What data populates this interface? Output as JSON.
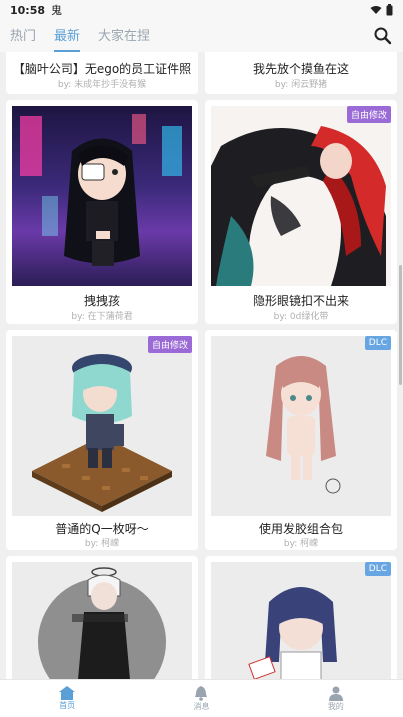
{
  "status": {
    "time": "10:58",
    "app_glyph": "鬼"
  },
  "tabs": [
    {
      "label": "热门"
    },
    {
      "label": "最新"
    },
    {
      "label": "大家在捏"
    }
  ],
  "cards": [
    {
      "title": "【脑叶公司】无ego的员工证件照",
      "author": "by: 末成年抄手没有猴",
      "badge": ""
    },
    {
      "title": "我先放个摸鱼在这",
      "author": "by: 闲云野猪",
      "badge": ""
    },
    {
      "title": "拽拽孩",
      "author": "by: 在下蒲荷君",
      "badge": ""
    },
    {
      "title": "隐形眼镜扣不出来",
      "author": "by: 0d绿化带",
      "badge": "自由修改"
    },
    {
      "title": "普通的Q一枚呀～",
      "author": "by: 柯嵘",
      "badge": "自由修改"
    },
    {
      "title": "使用发胶组合包",
      "author": "by: 柯嵘",
      "badge": "DLC"
    },
    {
      "title": "",
      "author": "",
      "badge": ""
    },
    {
      "title": "",
      "author": "",
      "badge": "DLC"
    }
  ],
  "bottom_nav": [
    {
      "label": "首页"
    },
    {
      "label": "消息"
    },
    {
      "label": "我的"
    }
  ],
  "colors": {
    "accent": "#5a9fd6",
    "badge_purple": "#9a6bd6",
    "badge_blue": "#67a6e2"
  }
}
